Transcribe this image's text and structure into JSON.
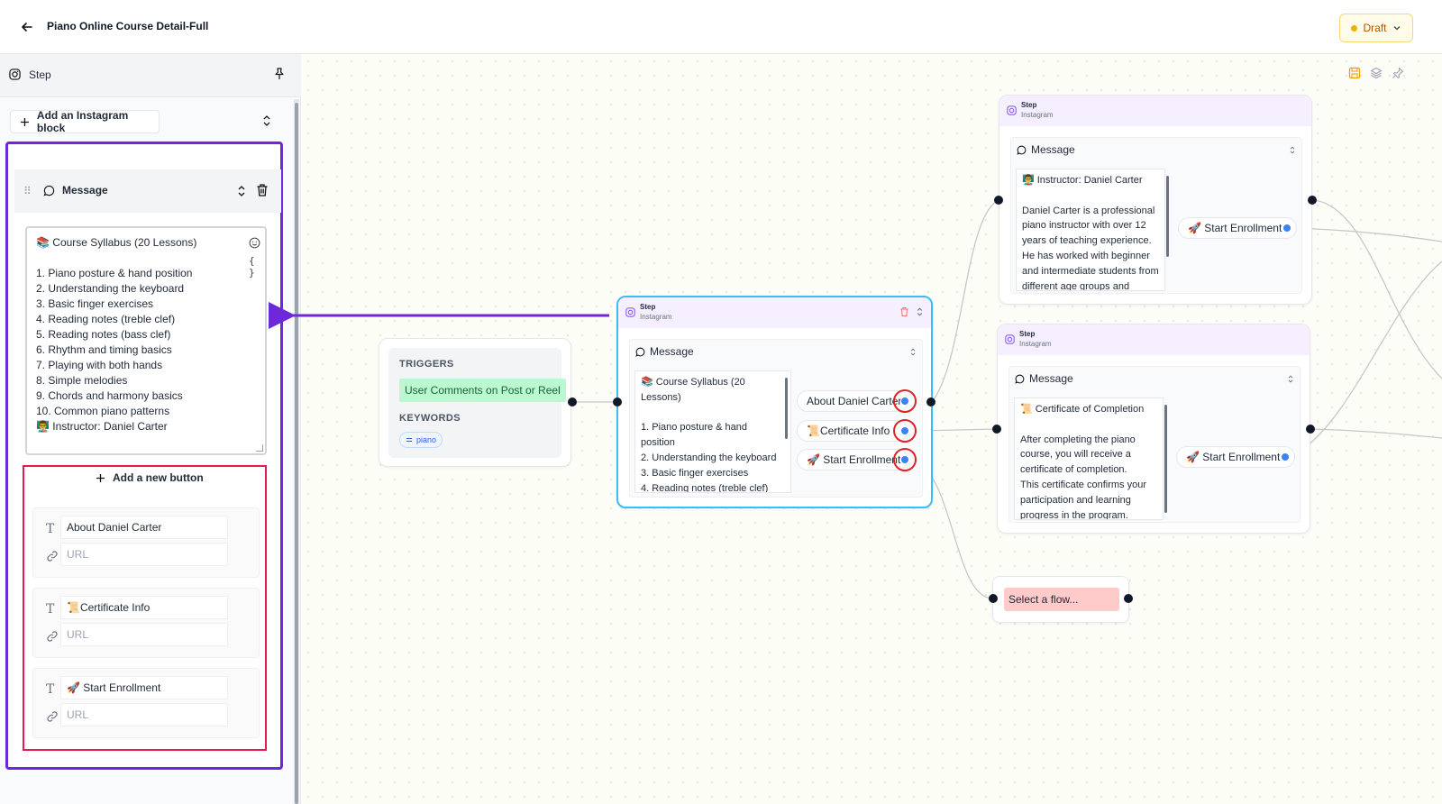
{
  "header": {
    "title": "Piano Online Course Detail-Full",
    "status_label": "Draft"
  },
  "sidebar": {
    "step_label": "Step",
    "add_block_label": "Add an Instagram block",
    "message_label": "Message",
    "message_lines": [
      "📚 Course Syllabus (20 Lessons)",
      "",
      "1. Piano posture & hand position",
      "2. Understanding the keyboard",
      "3. Basic finger exercises",
      "4. Reading notes (treble clef)",
      "5. Reading notes (bass clef)",
      "6. Rhythm and timing basics",
      "7. Playing with both hands",
      "8. Simple melodies",
      "9. Chords and harmony basics",
      "10. Common piano patterns",
      "👨‍🏫 Instructor: Daniel Carter"
    ],
    "variables_symbol": "{ }",
    "add_button_label": "Add a new button",
    "buttons": [
      {
        "label": "About Daniel Carter",
        "url_placeholder": "URL"
      },
      {
        "label": "📜Certificate Info",
        "url_placeholder": "URL"
      },
      {
        "label": "🚀 Start Enrollment",
        "url_placeholder": "URL"
      }
    ]
  },
  "canvas": {
    "trigger": {
      "triggers_label": "TRIGGERS",
      "trigger_value": "User Comments on Post or Reel",
      "keywords_label": "KEYWORDS",
      "keyword": "piano"
    },
    "main_node": {
      "title": "Step",
      "subtitle": "Instagram",
      "message_label": "Message",
      "lines": [
        "📚 Course Syllabus (20",
        "Lessons)",
        "",
        "1. Piano posture & hand",
        "position",
        "2. Understanding the keyboard",
        "3. Basic finger exercises",
        "4. Reading notes (treble clef)"
      ],
      "buttons": [
        "About Daniel Carter",
        "📜Certificate Info",
        "🚀 Start Enrollment"
      ]
    },
    "instructor_node": {
      "title": "Step",
      "subtitle": "Instagram",
      "message_label": "Message",
      "lines": [
        "👨‍🏫 Instructor: Daniel Carter",
        "",
        "Daniel Carter is a professional",
        "piano instructor with over 12",
        "years of teaching experience.",
        "He has worked with beginner",
        "and intermediate students from",
        "different age groups and"
      ],
      "button": "🚀 Start Enrollment"
    },
    "certificate_node": {
      "title": "Step",
      "subtitle": "Instagram",
      "message_label": "Message",
      "lines": [
        "📜 Certificate of Completion",
        "",
        "After completing the piano",
        "course, you will receive a",
        "certificate of completion.",
        "This certificate confirms your",
        "participation and learning",
        "progress in the program."
      ],
      "button": "🚀 Start Enrollment"
    },
    "select_flow_label": "Select a flow..."
  },
  "colors": {
    "accent_purple": "#6d28d9",
    "highlight_red": "#e11d48",
    "selected_node_border": "#38bdf8",
    "trigger_green": "#bbf7d0",
    "select_flow_bg": "#fecaca"
  }
}
